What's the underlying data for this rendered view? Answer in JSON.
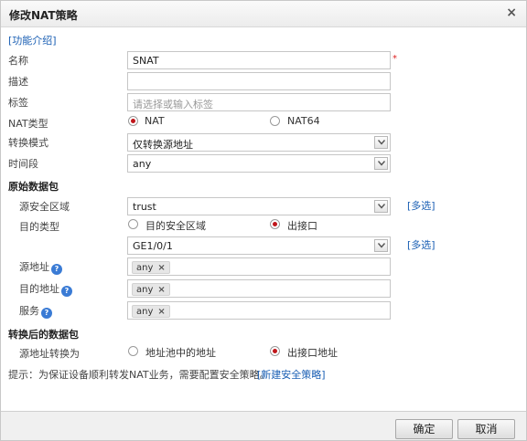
{
  "dialog": {
    "title": "修改NAT策略",
    "close_glyph": "×"
  },
  "intro_link": "[功能介绍]",
  "labels": {
    "name": "名称",
    "desc": "描述",
    "tag": "标签",
    "nat_type": "NAT类型",
    "mode": "转换模式",
    "time": "时间段",
    "orig_section": "原始数据包",
    "src_zone": "源安全区域",
    "dst_type": "目的类型",
    "src_addr": "源地址",
    "dst_addr": "目的地址",
    "service": "服务",
    "post_section": "转换后的数据包",
    "src_trans": "源地址转换为"
  },
  "fields": {
    "name_value": "SNAT",
    "required_mark": "*",
    "desc_value": "",
    "tag_placeholder": "请选择或输入标签",
    "mode_value": "仅转换源地址",
    "time_value": "any",
    "src_zone_value": "trust",
    "interface_value": "GE1/0/1"
  },
  "nat_type": {
    "option1": "NAT",
    "option2": "NAT64",
    "selected": "NAT"
  },
  "dst_type": {
    "option1": "目的安全区域",
    "option2": "出接口",
    "selected": "出接口"
  },
  "src_trans": {
    "option1": "地址池中的地址",
    "option2": "出接口地址",
    "selected": "出接口地址"
  },
  "multi_select": "[多选]",
  "tags": {
    "src_addr": "any",
    "dst_addr": "any",
    "service": "any",
    "remove_glyph": "×"
  },
  "help_glyph": "?",
  "hint": {
    "text": "提示：为保证设备顺利转发NAT业务，需要配置安全策略。",
    "link": "[新建安全策略]"
  },
  "buttons": {
    "ok": "确定",
    "cancel": "取消"
  }
}
